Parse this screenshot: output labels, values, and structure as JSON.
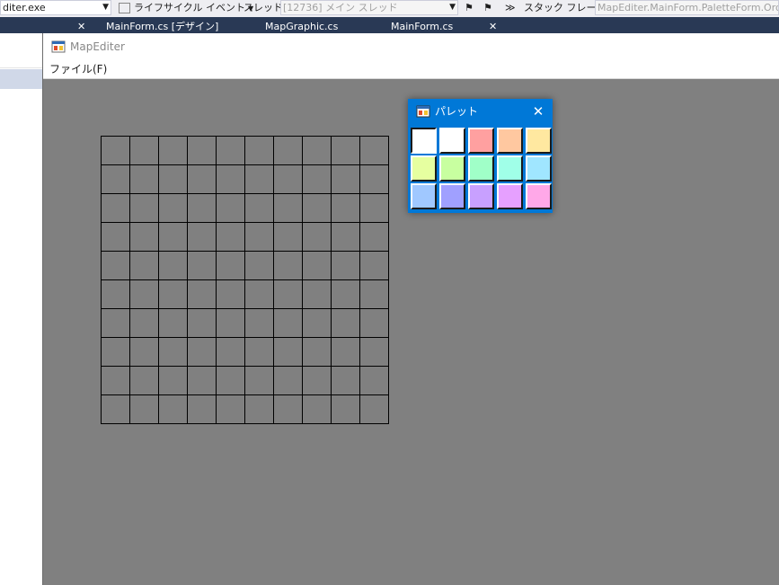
{
  "vs": {
    "process_combo": "diter.exe",
    "lifecycle_label": "ライフサイクル イベント",
    "thread_label": "スレッド:",
    "thread_combo": "[12736] メイン スレッド",
    "stackframe_label": "スタック フレーム:",
    "stackframe_combo": "MapEditer.MainForm.PaletteForm.Ord",
    "tabs": [
      "MainForm.cs [デザイン]",
      "MapGraphic.cs",
      "MainForm.cs"
    ]
  },
  "app": {
    "title": "MapEditer",
    "menu": [
      "ファイル(F)"
    ],
    "grid_cols": 10,
    "grid_rows": 10
  },
  "palette": {
    "title": "パレット",
    "close_glyph": "✕",
    "selected_index": 0,
    "colors": [
      "#ffffff",
      "#ffffff",
      "#ffa0a0",
      "#ffc8a0",
      "#ffe8a0",
      "#e6ffa0",
      "#c8ffa0",
      "#a0ffc8",
      "#a0ffe8",
      "#a0e6ff",
      "#a0c8ff",
      "#a0a0ff",
      "#c8a0ff",
      "#e6a0ff",
      "#ffa8e8"
    ]
  }
}
